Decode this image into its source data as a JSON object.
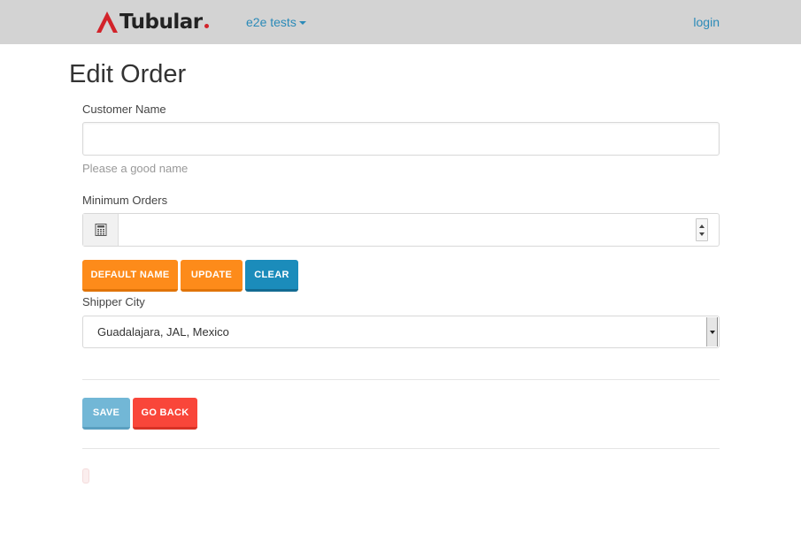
{
  "navbar": {
    "brand": "Tubular",
    "menu_label": "e2e tests",
    "login_label": "login",
    "colors": {
      "background": "#d3d3d3",
      "link": "#2a8ab8",
      "brand_dot": "#d2232a"
    }
  },
  "page": {
    "title": "Edit Order"
  },
  "form": {
    "customer_name": {
      "label": "Customer Name",
      "value": "",
      "help": "Please a good name"
    },
    "minimum_orders": {
      "label": "Minimum Orders",
      "value": "",
      "addon_icon": "calculator-icon"
    },
    "buttons": {
      "default_name": "DEFAULT NAME",
      "update": "UPDATE",
      "clear": "CLEAR"
    },
    "shipper_city": {
      "label": "Shipper City",
      "selected": "Guadalajara, JAL, Mexico"
    },
    "actions": {
      "save": "SAVE",
      "go_back": "GO BACK"
    }
  }
}
